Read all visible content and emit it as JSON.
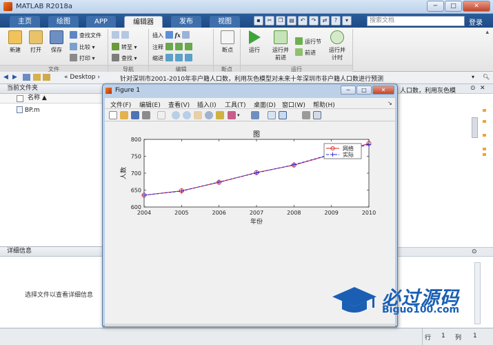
{
  "window": {
    "title": "MATLAB R2018a"
  },
  "tabs": [
    "主页",
    "绘图",
    "APP",
    "编辑器",
    "发布",
    "视图"
  ],
  "search": {
    "placeholder": "搜索文档"
  },
  "signin": "登录",
  "ribbon": {
    "file": {
      "new": "新建",
      "open": "打开",
      "save": "保存",
      "find_files": "查找文件",
      "compare": "比较",
      "print": "打印",
      "section": "文件"
    },
    "nav": {
      "goto": "转至",
      "find": "查找",
      "section": "导航"
    },
    "edit": {
      "insert": "插入",
      "comment": "注释",
      "indent": "缩进",
      "section": "编辑"
    },
    "breakpoints": {
      "label": "断点",
      "section": "断点"
    },
    "run": {
      "run": "运行",
      "run_advance_1": "运行并",
      "run_advance_2": "前进",
      "run_section": "运行节",
      "advance": "前进",
      "run_time_1": "运行并",
      "run_time_2": "计时",
      "section": "运行"
    }
  },
  "address": {
    "path_prefix": "«  Desktop  ›",
    "path": "针对深圳市2001-2010年非户籍人口数，利用灰色模型对未来十年深圳市非户籍人口数进行预测",
    "path_tail": "人口数，利用灰色模"
  },
  "current_folder": {
    "header": "当前文件夹",
    "column": "名称 ▲",
    "files": [
      "BP.m"
    ]
  },
  "details": {
    "header": "详细信息",
    "hint": "选择文件以查看详细信息"
  },
  "statusbar": {
    "row_label": "行",
    "row": "1",
    "col_label": "列",
    "col": "1"
  },
  "figure": {
    "title": "Figure 1",
    "menu": [
      "文件(F)",
      "编辑(E)",
      "查看(V)",
      "插入(I)",
      "工具(T)",
      "桌面(D)",
      "窗口(W)",
      "帮助(H)"
    ]
  },
  "chart_data": {
    "type": "line",
    "title": "图",
    "xlabel": "年份",
    "ylabel": "人数",
    "x": [
      2004,
      2005,
      2006,
      2007,
      2008,
      2009,
      2010
    ],
    "xlim": [
      2004,
      2010
    ],
    "ylim": [
      600,
      800
    ],
    "yticks": [
      600,
      650,
      700,
      750,
      800
    ],
    "grid": false,
    "legend_position": "top-right",
    "series": [
      {
        "name": "网络",
        "values": [
          635,
          648,
          673,
          702,
          724,
          755,
          788
        ],
        "color": "#e02020",
        "marker": "circle",
        "linestyle": "solid"
      },
      {
        "name": "实际",
        "values": [
          635,
          647,
          674,
          701,
          725,
          756,
          785
        ],
        "color": "#2020e0",
        "marker": "plus",
        "linestyle": "dashed"
      }
    ]
  },
  "watermark": {
    "text": "必过源码",
    "url": "Biguo100.com"
  }
}
